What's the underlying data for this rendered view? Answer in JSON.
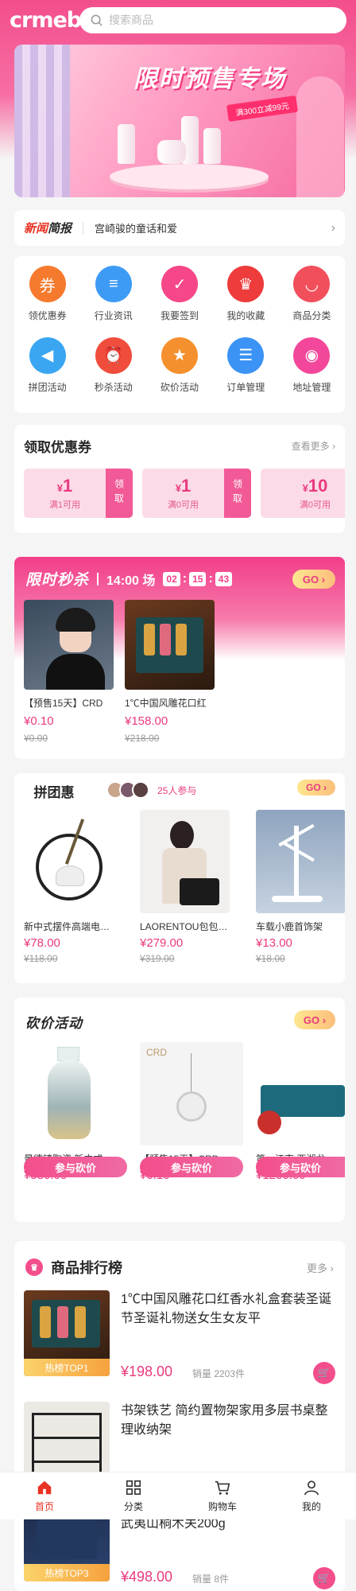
{
  "header": {
    "logo": "crmeb",
    "search_placeholder": "搜索商品"
  },
  "banner": {
    "title": "限时预售专场",
    "ribbon": "满300立减99元"
  },
  "news": {
    "tag_a": "新闻",
    "tag_b": "简报",
    "text": "宫崎骏的童话和爱"
  },
  "menu": [
    {
      "label": "领优惠券",
      "icon": "coupon-icon",
      "color": "#f57a2e"
    },
    {
      "label": "行业资讯",
      "icon": "news-icon",
      "color": "#3d9bf5"
    },
    {
      "label": "我要签到",
      "icon": "calendar-icon",
      "color": "#f5478a"
    },
    {
      "label": "我的收藏",
      "icon": "crown-icon",
      "color": "#ee3b3b"
    },
    {
      "label": "商品分类",
      "icon": "bag-icon",
      "color": "#f24f5c"
    },
    {
      "label": "拼团活动",
      "icon": "megaphone-icon",
      "color": "#3aa6f2"
    },
    {
      "label": "秒杀活动",
      "icon": "alarm-icon",
      "color": "#f04d3c"
    },
    {
      "label": "砍价活动",
      "icon": "badge-icon",
      "color": "#f5902e"
    },
    {
      "label": "订单管理",
      "icon": "order-icon",
      "color": "#3b93f5"
    },
    {
      "label": "地址管理",
      "icon": "location-icon",
      "color": "#f2479a"
    }
  ],
  "coupons": {
    "title": "领取优惠券",
    "more": "查看更多",
    "items": [
      {
        "amount": "1",
        "cond": "满1可用",
        "btn": "领取"
      },
      {
        "amount": "1",
        "cond": "满0可用",
        "btn": "领取"
      },
      {
        "amount": "10",
        "cond": "满0可用",
        "btn": ""
      }
    ]
  },
  "seckill": {
    "title": "限时秒杀",
    "slot": "14:00 场",
    "h": "02",
    "m": "15",
    "s": "43",
    "go": "GO",
    "items": [
      {
        "name": "【预售15天】CRD",
        "price": "¥0.10",
        "old": "¥0.00"
      },
      {
        "name": "1℃中国风雕花口红",
        "price": "¥158.00",
        "old": "¥218.00"
      }
    ]
  },
  "group": {
    "title": "拼团惠",
    "count": "25人参与",
    "go": "GO",
    "items": [
      {
        "name": "新中式摆件高端电…",
        "price": "¥78.00",
        "old": "¥118.00"
      },
      {
        "name": "LAORENTOU包包…",
        "price": "¥279.00",
        "old": "¥319.00"
      },
      {
        "name": "车载小鹿首饰架",
        "price": "¥13.00",
        "old": "¥18.00"
      }
    ]
  },
  "bargain": {
    "title": "砍价活动",
    "go": "GO",
    "btn": "参与砍价",
    "items": [
      {
        "name": "景德镇陶瓷 新中式…",
        "price": "¥580.00"
      },
      {
        "name": "【预售15天】CRD…",
        "price": "¥0.10"
      },
      {
        "name": "第一江南 西湖龙",
        "price": "¥1200.00"
      }
    ]
  },
  "rank": {
    "title": "商品排行榜",
    "more": "更多",
    "items": [
      {
        "name": "1℃中国风雕花口红香水礼盒套装圣诞节圣诞礼物送女生女友平",
        "badge": "热榜TOP1",
        "price": "¥198.00",
        "sales": "销量 2203件"
      },
      {
        "name": "书架铁艺 简约置物架家用多层书桌整理收纳架",
        "badge": "",
        "price": "",
        "sales": ""
      },
      {
        "name": "盛名世家余叶 特级金骏眉红茶礼盒装武夷山桐木关200g",
        "badge": "热榜TOP3",
        "price": "¥498.00",
        "sales": "销量 8件"
      }
    ]
  },
  "tabbar": [
    {
      "label": "首页",
      "icon": "home-icon",
      "active": true
    },
    {
      "label": "分类",
      "icon": "category-icon",
      "active": false
    },
    {
      "label": "购物车",
      "icon": "cart-icon",
      "active": false
    },
    {
      "label": "我的",
      "icon": "user-icon",
      "active": false
    }
  ],
  "colors": {
    "accent": "#f34e8c",
    "price": "#e93a7f",
    "tab_active": "#e93323"
  }
}
